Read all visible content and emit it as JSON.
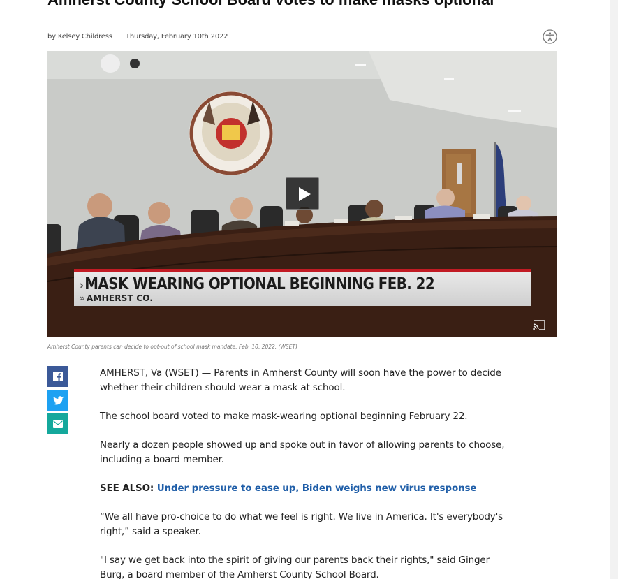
{
  "article": {
    "headline": "Amherst County School Board votes to make masks optional",
    "author": "by Kelsey Childress",
    "byline_separator": "|",
    "date": "Thursday, February 10th 2022",
    "accessibility_icon": "accessibility-icon",
    "video": {
      "lower_third_title": "MASK WEARING OPTIONAL BEGINNING FEB. 22",
      "lower_third_subtitle": "AMHERST CO.",
      "play_icon": "play-icon",
      "cast_icon": "cast-icon"
    },
    "caption": "Amherst County parents can decide to opt-out of school mask mandate, Feb. 10, 2022. (WSET)",
    "share": [
      {
        "icon": "facebook-icon",
        "color": "#3b5998"
      },
      {
        "icon": "twitter-icon",
        "color": "#1da1f2"
      },
      {
        "icon": "email-icon",
        "color": "#14a89c"
      }
    ],
    "paragraphs": {
      "p1": "AMHERST, Va (WSET) — Parents in Amherst County will soon have the power to decide whether their children should wear a mask at school.",
      "p2": "The school board voted to make mask-wearing optional beginning February 22.",
      "p3": "Nearly a dozen people showed up and spoke out in favor of allowing parents to choose, including a board member.",
      "see_also_label": "SEE ALSO:",
      "see_also_link": "Under pressure to ease up, Biden weighs new virus response",
      "p4": "“We all have pro-choice to do what we feel is right. We live in America. It's everybody's right,” said a speaker.",
      "p5": "\"I say we get back into the spirit of giving our parents back their rights,\" said Ginger Burg, a board member of the Amherst County School Board."
    }
  },
  "colors": {
    "link": "#1f5ea8",
    "lower_third_red": "#c21b24"
  }
}
